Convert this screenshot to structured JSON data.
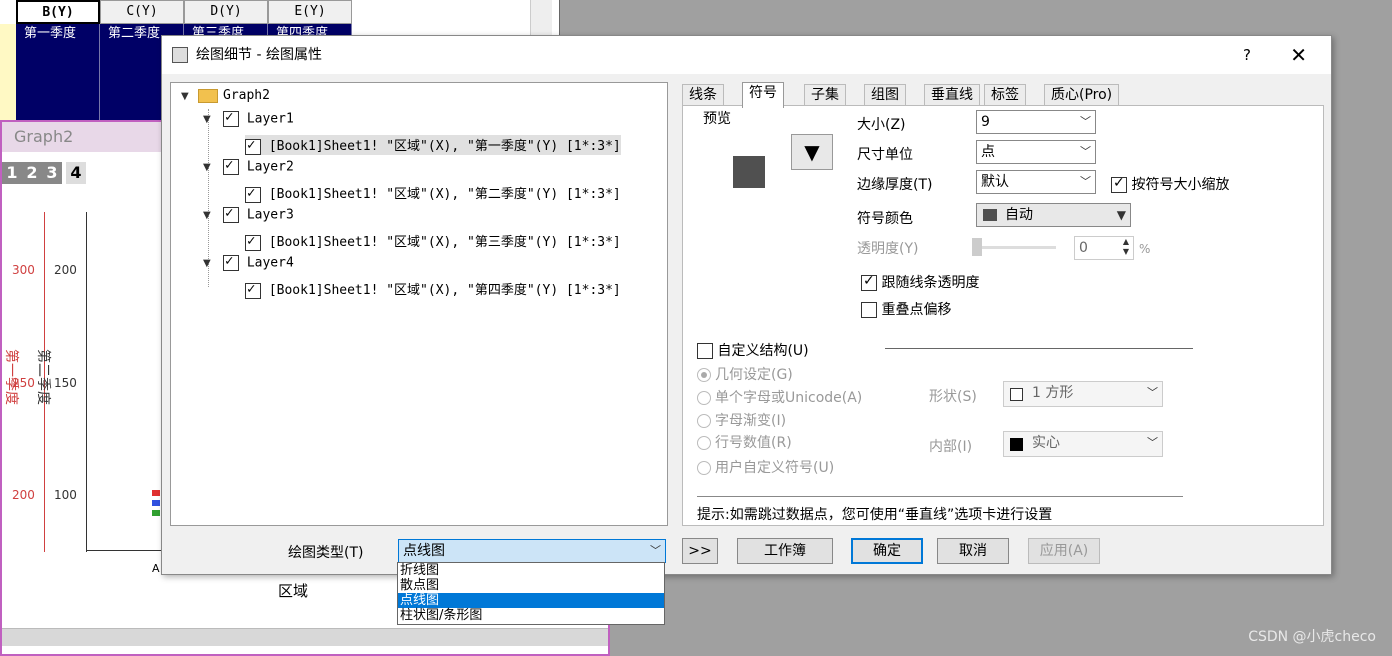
{
  "sheet": {
    "columns": [
      "B(Y)",
      "C(Y)",
      "D(Y)",
      "E(Y)"
    ],
    "row1": [
      "第一季度",
      "第二季度",
      "第三季度",
      "第四季度"
    ]
  },
  "graph": {
    "title": "Graph2",
    "layers": [
      "1",
      "2",
      "3",
      "4"
    ],
    "red_ticks": [
      "300",
      "250",
      "200"
    ],
    "black_ticks": [
      "200",
      "150",
      "100"
    ],
    "red_axis_label": "第一季度",
    "black_axis_label": "第二季度",
    "x_label": "区域",
    "x_tick": "A"
  },
  "dialog": {
    "title": "绘图细节 - 绘图属性",
    "help": "?",
    "close": "✕",
    "tree": {
      "root": "Graph2",
      "layers": [
        {
          "name": "Layer1",
          "plot": "[Book1]Sheet1! \"区域\"(X), \"第一季度\"(Y) [1*:3*]"
        },
        {
          "name": "Layer2",
          "plot": "[Book1]Sheet1! \"区域\"(X), \"第二季度\"(Y) [1*:3*]"
        },
        {
          "name": "Layer3",
          "plot": "[Book1]Sheet1! \"区域\"(X), \"第三季度\"(Y) [1*:3*]"
        },
        {
          "name": "Layer4",
          "plot": "[Book1]Sheet1! \"区域\"(X), \"第四季度\"(Y) [1*:3*]"
        }
      ]
    },
    "tabs": [
      "线条",
      "符号",
      "子集",
      "组图",
      "垂直线",
      "标签",
      "质心(Pro)"
    ],
    "active_tab": "符号",
    "symbol": {
      "preview_label": "预览",
      "size_label": "大小(Z)",
      "size_value": "9",
      "unit_label": "尺寸单位",
      "unit_value": "点",
      "edge_label": "边缘厚度(T)",
      "edge_value": "默认",
      "scale_check": "按符号大小缩放",
      "color_label": "符号颜色",
      "color_value": "自动",
      "transparency_label": "透明度(Y)",
      "transparency_value": "0",
      "transparency_unit": "%",
      "follow_line": "跟随线条透明度",
      "overlap": "重叠点偏移",
      "custom_struct": "自定义结构(U)",
      "radio_geometry": "几何设定(G)",
      "radio_char": "单个字母或Unicode(A)",
      "radio_gradient": "字母渐变(I)",
      "radio_rownum": "行号数值(R)",
      "radio_user": "用户自定义符号(U)",
      "shape_label": "形状(S)",
      "shape_value": "1 方形",
      "interior_label": "内部(I)",
      "interior_value": "实心",
      "hint": "提示:如需跳过数据点，您可使用“垂直线”选项卡进行设置"
    },
    "plot_type_label": "绘图类型(T)",
    "plot_type_value": "点线图",
    "plot_type_options": [
      "折线图",
      "散点图",
      "点线图",
      "柱状图/条形图"
    ],
    "buttons": {
      "expand": ">>",
      "workbook": "工作簿",
      "ok": "确定",
      "cancel": "取消",
      "apply": "应用(A)"
    }
  },
  "watermark": "CSDN @小虎checo"
}
